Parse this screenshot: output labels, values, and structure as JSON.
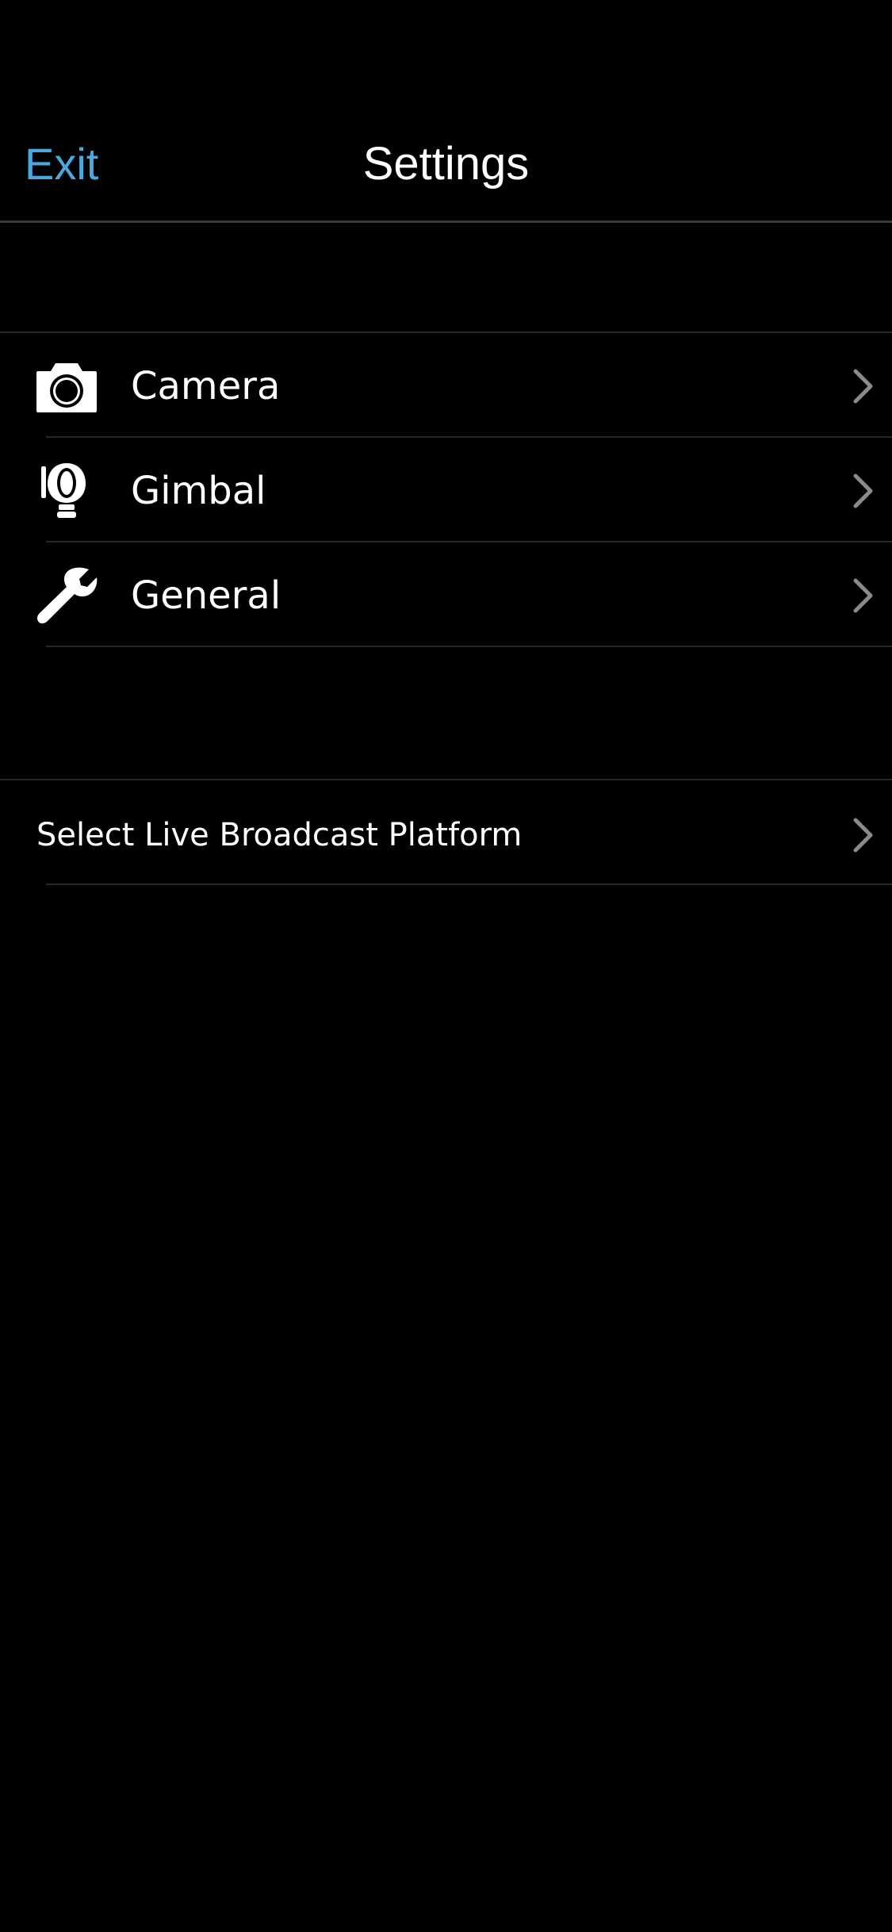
{
  "nav": {
    "exit_label": "Exit",
    "title": "Settings"
  },
  "settings_group": {
    "items": [
      {
        "label": "Camera",
        "icon": "camera-icon"
      },
      {
        "label": "Gimbal",
        "icon": "gimbal-icon"
      },
      {
        "label": "General",
        "icon": "wrench-icon"
      }
    ]
  },
  "broadcast_group": {
    "items": [
      {
        "label": "Select Live Broadcast Platform",
        "icon": "chevron-right-icon"
      }
    ]
  },
  "colors": {
    "background": "#000000",
    "accent": "#4aa8de",
    "text": "#ffffff",
    "divider": "#262626",
    "chevron": "#8a8a8a"
  }
}
